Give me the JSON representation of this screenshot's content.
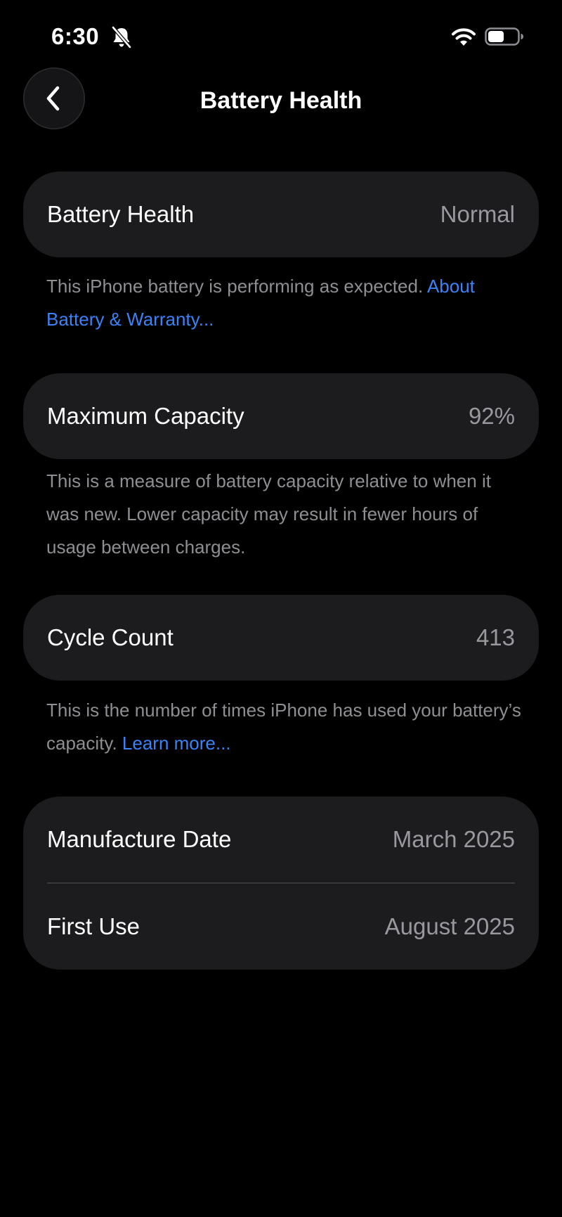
{
  "status_bar": {
    "time": "6:30",
    "icons": [
      "bell-slash-icon",
      "wifi-icon",
      "battery-icon"
    ],
    "battery_level": 0.55
  },
  "nav": {
    "back_icon": "chevron-left-icon",
    "title": "Battery Health"
  },
  "battery_health": {
    "label": "Battery Health",
    "value": "Normal",
    "footnote": "This iPhone battery is performing as expected. ",
    "link": "About Battery & Warranty..."
  },
  "maximum_capacity": {
    "label": "Maximum Capacity",
    "value": "92%",
    "footnote": "This is a measure of battery capacity relative to when it was new. Lower capacity may result in fewer hours of usage between charges."
  },
  "cycle_count": {
    "label": "Cycle Count",
    "value": "413",
    "footnote": "This is the number of times iPhone has used your battery’s capacity. ",
    "link": "Learn more..."
  },
  "dates": {
    "manufacture_label": "Manufacture Date",
    "manufacture_value": "March 2025",
    "first_use_label": "First Use",
    "first_use_value": "August 2025"
  },
  "colors": {
    "background": "#000000",
    "card": "#1c1c1e",
    "secondary_text": "#98989f",
    "link": "#3b82f6"
  }
}
